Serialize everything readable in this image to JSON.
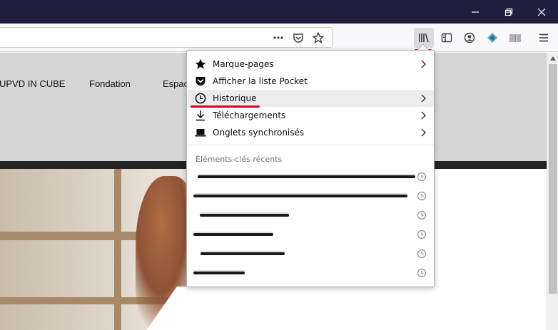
{
  "window_controls": {
    "minimize": "minimize",
    "restore": "restore",
    "close": "close"
  },
  "site": {
    "nav_items": [
      "UPVD IN CUBE",
      "Fondation",
      "Espac"
    ]
  },
  "library_panel": {
    "menu_items": [
      {
        "label": "Marque-pages",
        "icon": "star-icon",
        "has_submenu": true
      },
      {
        "label": "Afficher la liste Pocket",
        "icon": "pocket-icon",
        "has_submenu": false
      },
      {
        "label": "Historique",
        "icon": "clock-icon",
        "has_submenu": true,
        "highlighted": true
      },
      {
        "label": "Téléchargements",
        "icon": "download-icon",
        "has_submenu": true
      },
      {
        "label": "Onglets synchronisés",
        "icon": "laptop-icon",
        "has_submenu": true
      }
    ],
    "recent_title": "Éléments-clés récents",
    "recent_count_visible": 6
  },
  "colors": {
    "titlebar": "#1f1f3d",
    "annotation_red": "#d70022",
    "hover_bg": "#ededf0",
    "site_header": "#d6d6d6"
  }
}
